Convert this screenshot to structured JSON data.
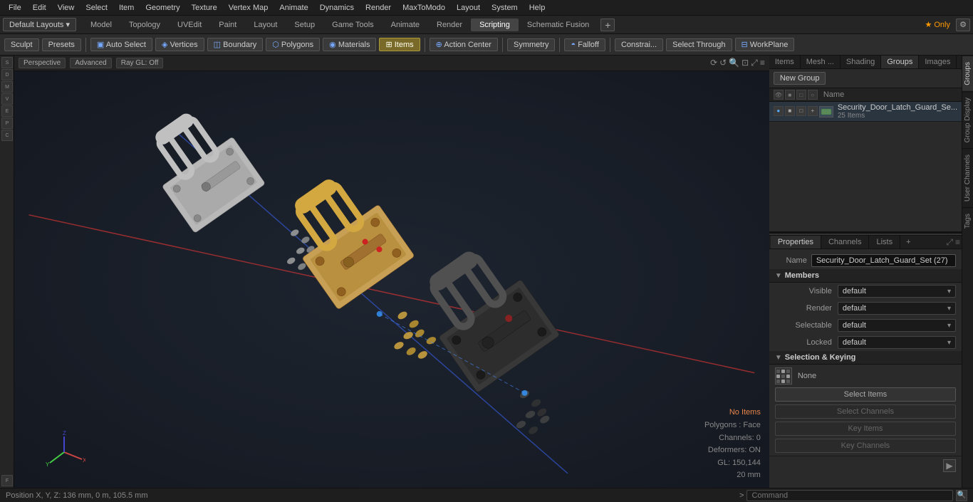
{
  "menubar": {
    "items": [
      "File",
      "Edit",
      "View",
      "Select",
      "Item",
      "Geometry",
      "Texture",
      "Vertex Map",
      "Animate",
      "Dynamics",
      "Render",
      "MaxToModo",
      "Layout",
      "System",
      "Help"
    ]
  },
  "layout_bar": {
    "default_layouts": "Default Layouts ▾",
    "tabs": [
      "Model",
      "Topology",
      "UVEdit",
      "Paint",
      "Layout",
      "Setup",
      "Game Tools",
      "Animate",
      "Render",
      "Scripting",
      "Schematic Fusion"
    ],
    "star_badge": "★  Only",
    "active_tab": "Scripting"
  },
  "toolbar": {
    "sculpt": "Sculpt",
    "presets": "Presets",
    "auto_select": "Auto Select",
    "vertices": "Vertices",
    "boundary": "Boundary",
    "polygons": "Polygons",
    "materials": "Materials",
    "items": "Items",
    "action_center": "Action Center",
    "symmetry": "Symmetry",
    "falloff": "Falloff",
    "constraints": "Constrai...",
    "select_through": "Select Through",
    "workplane": "WorkPlane"
  },
  "viewport": {
    "mode": "Perspective",
    "quality": "Advanced",
    "raygl": "Ray GL: Off",
    "status": {
      "no_items": "No Items",
      "polygons": "Polygons : Face",
      "channels": "Channels: 0",
      "deformers": "Deformers: ON",
      "gl": "GL: 150,144",
      "scale": "20 mm"
    }
  },
  "right_panel": {
    "tabs": [
      "Items",
      "Mesh ...",
      "Shading",
      "Groups",
      "Images"
    ],
    "active_tab": "Groups"
  },
  "groups": {
    "new_group_btn": "New Group",
    "list_header": "Name",
    "group_item": {
      "name": "Security_Door_Latch_Guard_Se...",
      "count": "25 Items"
    }
  },
  "props": {
    "tabs": [
      "Properties",
      "Channels",
      "Lists"
    ],
    "active_tab": "Properties",
    "name_label": "Name",
    "name_value": "Security_Door_Latch_Guard_Set (27)",
    "members_section": "Members",
    "fields": [
      {
        "label": "Visible",
        "value": "default"
      },
      {
        "label": "Render",
        "value": "default"
      },
      {
        "label": "Selectable",
        "value": "default"
      },
      {
        "label": "Locked",
        "value": "default"
      }
    ],
    "selection_keying_section": "Selection & Keying",
    "keying_none": "None",
    "select_items_btn": "Select Items",
    "select_channels_btn": "Select Channels",
    "key_items_btn": "Key Items",
    "key_channels_btn": "Key Channels"
  },
  "vtabs": [
    "Groups",
    "Group Display",
    "User Channels",
    "Tags"
  ],
  "status_bar": {
    "position": "Position X, Y, Z:   136 mm, 0 m, 105.5 mm",
    "command_placeholder": "Command"
  },
  "left_tools": [
    "S",
    "D",
    "M",
    "V",
    "E",
    "P",
    "C",
    "F"
  ]
}
